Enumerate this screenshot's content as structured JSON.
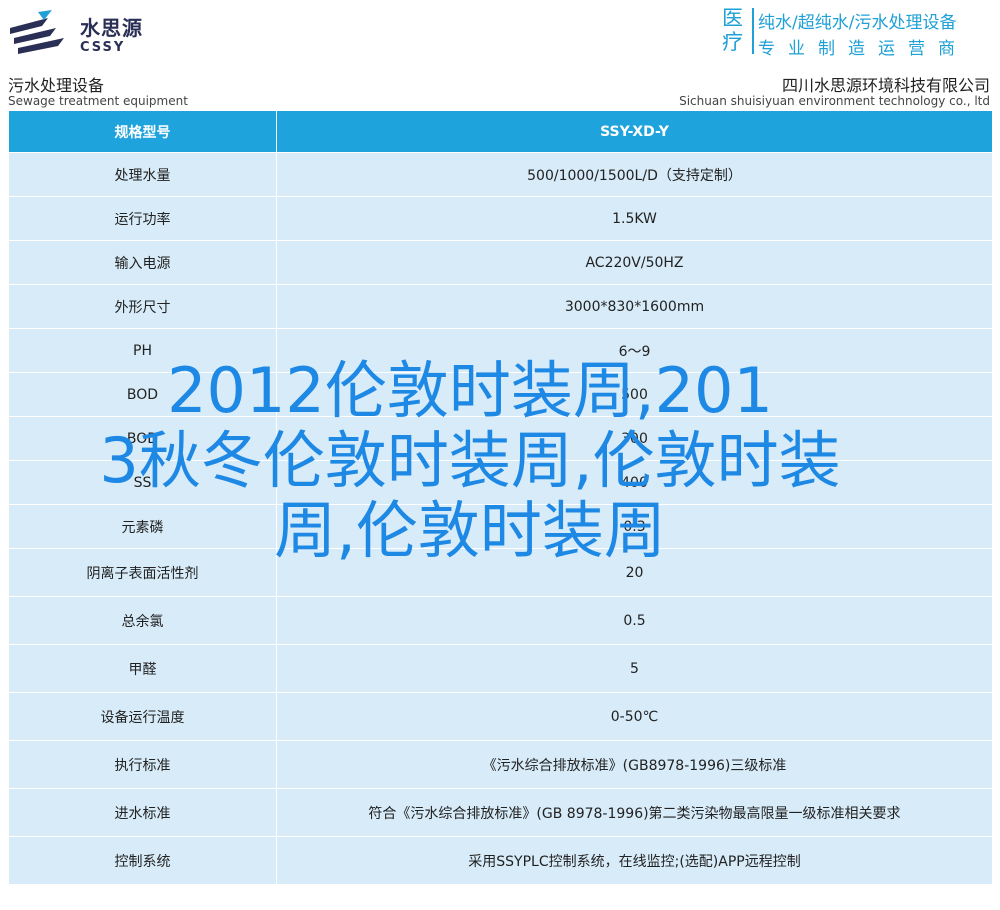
{
  "header": {
    "logo_cn": "水思源",
    "logo_en": "CSSY",
    "brand_big": "医疗",
    "brand_line1": "纯水/超纯水/污水处理设备",
    "brand_line2": "专业制造运营商"
  },
  "titlebar": {
    "left_cn": "污水处理设备",
    "left_en": "Sewage treatment equipment",
    "right_cn": "四川水思源环境科技有限公司",
    "right_en": "Sichuan shuisiyuan environment technology co., ltd"
  },
  "table": {
    "header": {
      "label": "规格型号",
      "value": "SSY-XD-Y"
    },
    "rows": [
      {
        "label": "处理水量",
        "value": "500/1000/1500L/D（支持定制）"
      },
      {
        "label": "运行功率",
        "value": "1.5KW"
      },
      {
        "label": "输入电源",
        "value": "AC220V/50HZ"
      },
      {
        "label": "外形尺寸",
        "value": "3000*830*1600mm"
      },
      {
        "label": "PH",
        "value": "6～9"
      },
      {
        "label": "BOD",
        "value": "500"
      },
      {
        "label": "BOD",
        "value": "300"
      },
      {
        "label": "SS",
        "value": "400"
      },
      {
        "label": "元素磷",
        "value": "0.3"
      },
      {
        "label": "阴离子表面活性剂",
        "value": "20"
      },
      {
        "label": "总余氯",
        "value": "0.5"
      },
      {
        "label": "甲醛",
        "value": "5"
      },
      {
        "label": "设备运行温度",
        "value": "0-50℃"
      },
      {
        "label": "执行标准",
        "value": "《污水综合排放标准》(GB8978-1996)三级标准"
      },
      {
        "label": "进水标准",
        "value": "符合《污水综合排放标准》(GB 8978-1996)第二类污染物最高限量一级标准相关要求"
      },
      {
        "label": "控制系统",
        "value": "采用SSYPLC控制系统，在线监控;(选配)APP远程控制"
      }
    ]
  },
  "overlay": {
    "line1": "2012伦敦时装周,201",
    "line2": "3秋冬伦敦时装周,伦敦时装",
    "line3": "周,伦敦时装周"
  },
  "colors": {
    "accent": "#1ea3dc",
    "row_bg": "#d7ebf8",
    "overlay": "#1e88e5",
    "logo": "#2a2f55"
  }
}
